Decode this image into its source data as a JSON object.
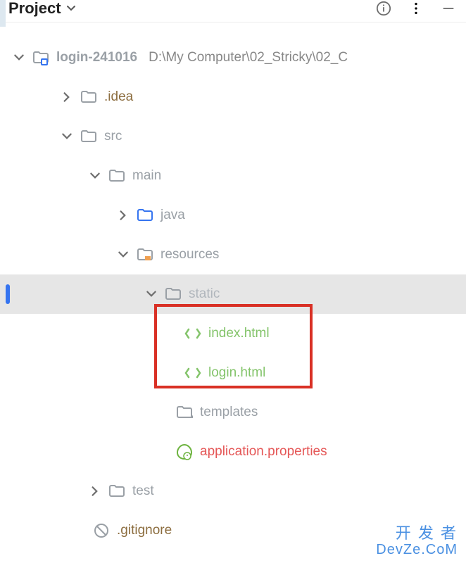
{
  "header": {
    "title": "Project"
  },
  "tree": {
    "root": {
      "name": "login-241016",
      "path": "D:\\My Computer\\02_Stricky\\02_C"
    },
    "idea": ".idea",
    "src": "src",
    "main": "main",
    "java": "java",
    "resources": "resources",
    "static": "static",
    "index_html": "index.html",
    "login_html": "login.html",
    "templates": "templates",
    "application_properties": "application.properties",
    "test": "test",
    "gitignore": ".gitignore"
  },
  "watermark": {
    "line1": "开 发 者",
    "line2": "DevZe.CoM"
  }
}
